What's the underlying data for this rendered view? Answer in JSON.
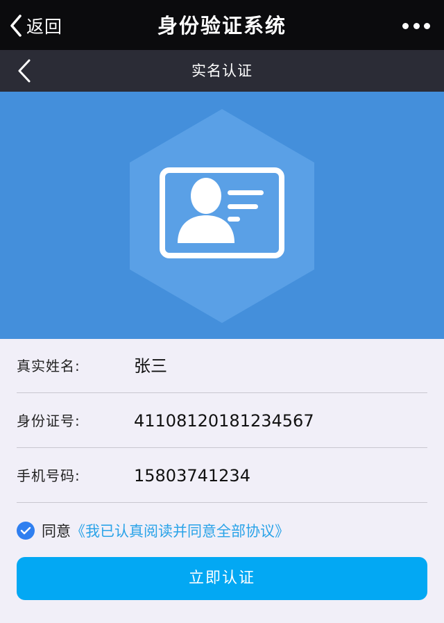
{
  "colors": {
    "top_bar": "#0b0b0d",
    "sub_bar": "#2b2c36",
    "hero_background": "#448fdb",
    "page_background": "#f1eff8",
    "accent": "#03a8f3",
    "link": "#2aa3e8",
    "checkbox": "#2f7ff0"
  },
  "top_bar": {
    "back_label": "返回",
    "title": "身份验证系统",
    "back_icon": "chevron-left-icon",
    "more_icon": "more-dots-icon"
  },
  "sub_bar": {
    "title": "实名认证",
    "back_icon": "chevron-left-icon"
  },
  "hero": {
    "icon": "id-card-icon"
  },
  "form": {
    "rows": [
      {
        "label": "真实姓名:",
        "value": "张三"
      },
      {
        "label": "身份证号:",
        "value": "41108120181234567"
      },
      {
        "label": "手机号码:",
        "value": "15803741234"
      }
    ]
  },
  "agreement": {
    "checked": true,
    "prefix": "同意",
    "link": "《我已认真阅读并同意全部协议》"
  },
  "submit": {
    "label": "立即认证"
  }
}
